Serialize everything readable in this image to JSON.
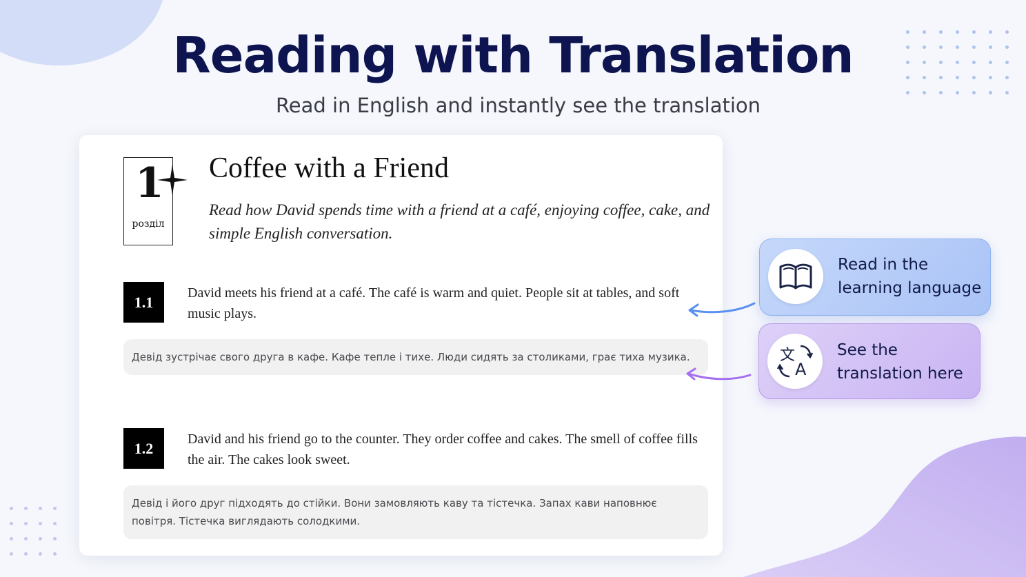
{
  "header": {
    "title": "Reading with Translation",
    "subtitle": "Read in English and instantly see the translation"
  },
  "chapter": {
    "number": "1",
    "word": "розділ",
    "title": "Coffee with a Friend",
    "description": "Read how David spends time with a friend at a café, enjoying coffee, cake, and simple English conversation."
  },
  "sections": [
    {
      "number": "1.1",
      "text": "David meets his friend at a café. The café is warm and quiet. People sit at tables, and soft music plays.",
      "translation": "Девід зустрічає свого друга в кафе. Кафе тепле і тихе. Люди сидять за столиками, грає тиха музика."
    },
    {
      "number": "1.2",
      "text": "David and his friend go to the counter. They order coffee and cakes. The smell of coffee fills the air. The cakes look sweet.",
      "translation": "Девід і його друг підходять до стійки. Вони замовляють каву та тістечка. Запах кави наповнює повітря. Тістечка виглядають солодкими."
    }
  ],
  "callouts": {
    "read": {
      "line1": "Read in the",
      "line2": "learning language",
      "icon": "book-icon"
    },
    "translation": {
      "line1": "See the",
      "line2": "translation here",
      "icon": "translate-icon"
    }
  },
  "colors": {
    "title": "#0d1450",
    "callout_blue": "#a9c3f6",
    "callout_purple": "#c9b4f3",
    "arrow_blue": "#5b8ff0",
    "arrow_purple": "#a46ef0"
  }
}
